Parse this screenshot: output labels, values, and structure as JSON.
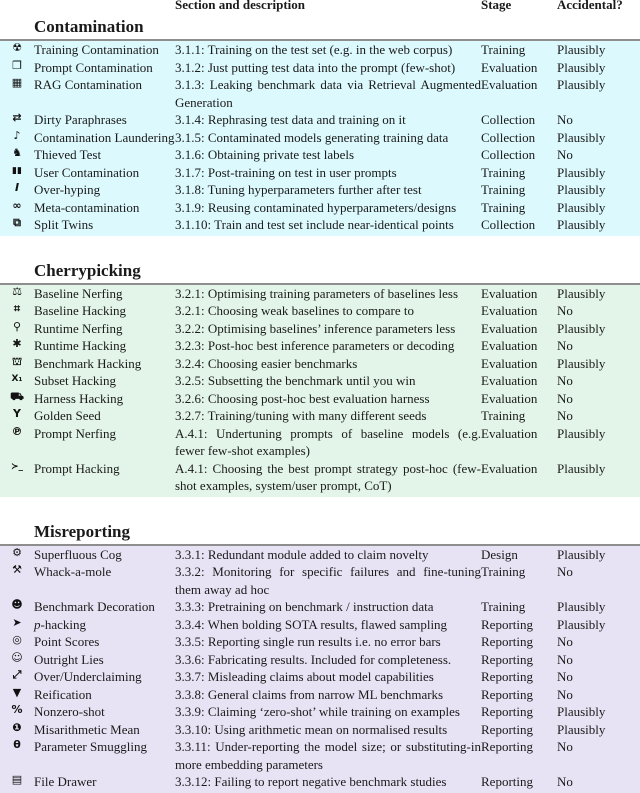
{
  "header": {
    "col_description": "Section and description",
    "col_stage": "Stage",
    "col_accidental": "Accidental?"
  },
  "sections": [
    {
      "title": "Contamination",
      "color": "#dcf9fd",
      "rows": [
        {
          "icon": "radiation-icon",
          "name": "Training Contamination",
          "desc": "3.1.1: Training on the test set (e.g. in the web corpus)",
          "stage": "Training",
          "accidental": "Plausibly"
        },
        {
          "icon": "copy-icon",
          "name": "Prompt Contamination",
          "desc": "3.1.2: Just putting test data into the prompt (few-shot)",
          "stage": "Evaluation",
          "accidental": "Plausibly"
        },
        {
          "icon": "database-icon",
          "name": "RAG Contamination",
          "desc": "3.1.3: Leaking benchmark data via Retrieval Augmented Generation",
          "stage": "Evaluation",
          "accidental": "Plausibly"
        },
        {
          "icon": "shuffle-icon",
          "name": "Dirty Paraphrases",
          "desc": "3.1.4: Rephrasing test data and training on it",
          "stage": "Collection",
          "accidental": "No"
        },
        {
          "icon": "socks-icon",
          "name": "Contamination Laundering",
          "desc": "3.1.5: Contaminated models generating training data",
          "stage": "Collection",
          "accidental": "Plausibly"
        },
        {
          "icon": "thief-icon",
          "name": "Thieved Test",
          "desc": "3.1.6: Obtaining private test labels",
          "stage": "Collection",
          "accidental": "No"
        },
        {
          "icon": "book-open-icon",
          "name": "User Contamination",
          "desc": "3.1.7: Post-training on test in user prompts",
          "stage": "Training",
          "accidental": "Plausibly"
        },
        {
          "icon": "italic-i-icon",
          "name": "Over-hyping",
          "desc": "3.1.8: Tuning hyperparameters further after test",
          "stage": "Training",
          "accidental": "Plausibly"
        },
        {
          "icon": "link-icon",
          "name": "Meta-contamination",
          "desc": "3.1.9: Reusing contaminated hyperparameters/designs",
          "stage": "Training",
          "accidental": "Plausibly"
        },
        {
          "icon": "clone-icon",
          "name": "Split Twins",
          "desc": "3.1.10: Train and test set include near-identical points",
          "stage": "Collection",
          "accidental": "Plausibly"
        }
      ]
    },
    {
      "title": "Cherrypicking",
      "color": "#e3f5e8",
      "rows": [
        {
          "icon": "scale-icon",
          "name": "Baseline Nerfing",
          "desc": "3.2.1: Optimising training parameters of baselines less",
          "stage": "Evaluation",
          "accidental": "Plausibly"
        },
        {
          "icon": "compress-icon",
          "name": "Baseline Hacking",
          "desc": "3.2.1: Choosing weak baselines to compare to",
          "stage": "Evaluation",
          "accidental": "No"
        },
        {
          "icon": "running-icon",
          "name": "Runtime Nerfing",
          "desc": "3.2.2: Optimising baselines’ inference parameters less",
          "stage": "Evaluation",
          "accidental": "Plausibly"
        },
        {
          "icon": "asterisk-icon",
          "name": "Runtime Hacking",
          "desc": "3.2.3: Post-hoc best inference parameters or decoding",
          "stage": "Evaluation",
          "accidental": "No"
        },
        {
          "icon": "basket-icon",
          "name": "Benchmark Hacking",
          "desc": "3.2.4: Choosing easier benchmarks",
          "stage": "Evaluation",
          "accidental": "Plausibly"
        },
        {
          "icon": "subscript-x-icon",
          "name": "Subset Hacking",
          "desc": "3.2.5: Subsetting the benchmark until you win",
          "stage": "Evaluation",
          "accidental": "No"
        },
        {
          "icon": "cart-icon",
          "name": "Harness Hacking",
          "desc": "3.2.6: Choosing post-hoc best evaluation harness",
          "stage": "Evaluation",
          "accidental": "No"
        },
        {
          "icon": "seedling-icon",
          "name": "Golden Seed",
          "desc": "3.2.7: Training/tuning with many different seeds",
          "stage": "Training",
          "accidental": "No"
        },
        {
          "icon": "hairdryer-icon",
          "name": "Prompt Nerfing",
          "desc": "A.4.1: Undertuning prompts of baseline models (e.g. fewer few-shot examples)",
          "stage": "Evaluation",
          "accidental": "Plausibly"
        },
        {
          "icon": "terminal-icon",
          "name": "Prompt Hacking",
          "desc": "A.4.1: Choosing the best prompt strategy post-hoc (few-shot examples, system/user prompt, CoT)",
          "stage": "Evaluation",
          "accidental": "Plausibly"
        }
      ]
    },
    {
      "title": "Misreporting",
      "color": "#e8e3f4",
      "rows": [
        {
          "icon": "cogs-icon",
          "name": "Superfluous Cog",
          "desc": "3.3.1: Redundant module added to claim novelty",
          "stage": "Design",
          "accidental": "Plausibly"
        },
        {
          "icon": "hammer-icon",
          "name": "Whack-a-mole",
          "desc": "3.3.2: Monitoring for specific failures and fine-tuning them away ad hoc",
          "stage": "Training",
          "accidental": "No"
        },
        {
          "icon": "masks-icon",
          "name": "Benchmark Decoration",
          "desc": "3.3.3: Pretraining on benchmark / instruction data",
          "stage": "Training",
          "accidental": "Plausibly"
        },
        {
          "icon": "fish-icon",
          "name_prefix": "p",
          "name": "-hacking",
          "desc": "3.3.4: When bolding SOTA results, flawed sampling",
          "stage": "Reporting",
          "accidental": "Plausibly"
        },
        {
          "icon": "bullseye-icon",
          "name": "Point Scores",
          "desc": "3.3.5: Reporting single run results i.e. no error bars",
          "stage": "Reporting",
          "accidental": "No"
        },
        {
          "icon": "smile-icon",
          "name": "Outright Lies",
          "desc": "3.3.6: Fabricating results. Included for completeness.",
          "stage": "Reporting",
          "accidental": "No"
        },
        {
          "icon": "expand-arrows-icon",
          "name": "Over/Underclaiming",
          "desc": "3.3.7: Misleading claims about model capabilities",
          "stage": "Reporting",
          "accidental": "No"
        },
        {
          "icon": "dripping-icon",
          "name": "Reification",
          "desc": "3.3.8: General claims from narrow ML benchmarks",
          "stage": "Reporting",
          "accidental": "No"
        },
        {
          "icon": "percent-icon",
          "name": "Nonzero-shot",
          "desc": "3.3.9: Claiming ‘zero-shot’ while training on examples",
          "stage": "Reporting",
          "accidental": "Plausibly"
        },
        {
          "icon": "exclamation-circle-icon",
          "name": "Misarithmetic Mean",
          "desc": "3.3.10: Using arithmetic mean on normalised results",
          "stage": "Reporting",
          "accidental": "Plausibly"
        },
        {
          "icon": "theta-icon",
          "name": "Parameter Smuggling",
          "desc": "3.3.11: Under-reporting the model size; or substituting-in more embedding parameters",
          "stage": "Reporting",
          "accidental": "No"
        },
        {
          "icon": "file-cabinet-icon",
          "name": "File Drawer",
          "desc": "3.3.12: Failing to report negative benchmark studies",
          "stage": "Reporting",
          "accidental": "No"
        }
      ]
    }
  ]
}
